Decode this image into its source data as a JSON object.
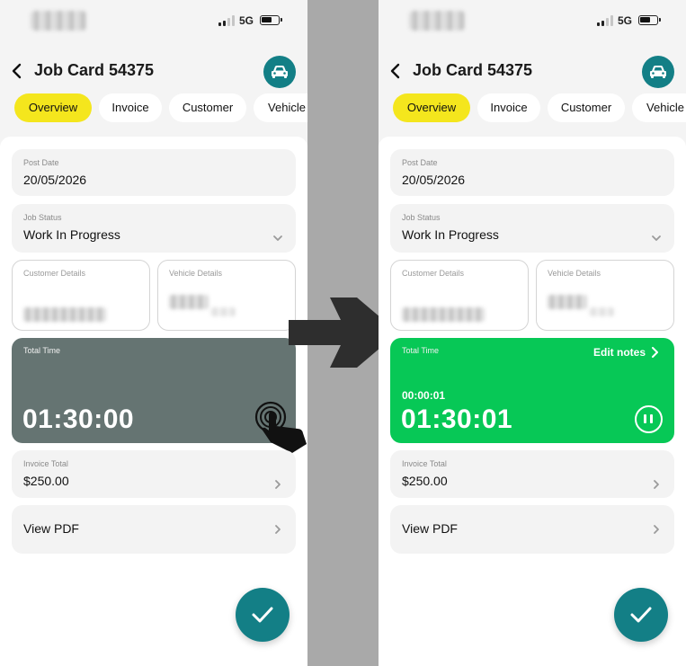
{
  "status_bar": {
    "network": "5G"
  },
  "header": {
    "title": "Job Card 54375"
  },
  "tabs": [
    {
      "label": "Overview"
    },
    {
      "label": "Invoice"
    },
    {
      "label": "Customer"
    },
    {
      "label": "Vehicle"
    }
  ],
  "fields": {
    "post_date": {
      "label": "Post Date",
      "value": "20/05/2026"
    },
    "job_status": {
      "label": "Job Status",
      "value": "Work In Progress"
    },
    "customer_details": {
      "label": "Customer Details"
    },
    "vehicle_details": {
      "label": "Vehicle Details"
    },
    "invoice_total": {
      "label": "Invoice Total",
      "value": "$250.00"
    },
    "view_pdf": {
      "label": "View PDF"
    }
  },
  "timer_before": {
    "label": "Total Time",
    "value": "01:30:00"
  },
  "timer_after": {
    "label": "Total Time",
    "edit_label": "Edit notes",
    "session": "00:00:01",
    "value": "01:30:01"
  },
  "colors": {
    "accent": "#137f86",
    "active_tab": "#f4e61d",
    "timer_idle": "#657472",
    "timer_running": "#07c856"
  },
  "icons": [
    "back-chevron-icon",
    "vehicle-icon",
    "chevron-down-icon",
    "chevron-right-icon",
    "pause-icon",
    "checkmark-icon",
    "tap-gesture-icon",
    "right-arrow-icon"
  ]
}
